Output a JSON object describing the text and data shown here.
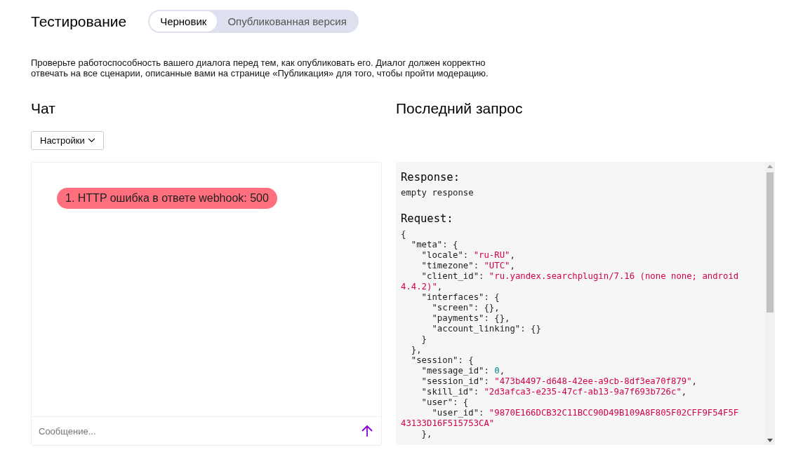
{
  "header": {
    "title": "Тестирование",
    "tabs": [
      {
        "label": "Черновик",
        "selected": true
      },
      {
        "label": "Опубликованная версия",
        "selected": false
      }
    ]
  },
  "description": "Проверьте работоспособность вашего диалога перед тем, как опубликовать его. Диалог должен корректно отвечать на все сценарии, описанные вами на странице «Публикация» для того, чтобы пройти модерацию.",
  "chat": {
    "heading": "Чат",
    "settings_button": "Настройки",
    "messages": [
      {
        "text": "1. HTTP ошибка в ответе webhook: 500",
        "kind": "error"
      }
    ],
    "input": {
      "placeholder": "Сообщение..."
    }
  },
  "last_request": {
    "heading": "Последний запрос",
    "response_label": "Response:",
    "response_text": "empty response",
    "request_label": "Request:",
    "code_lines": [
      [
        {
          "kind": "plain",
          "text": "{"
        }
      ],
      [
        {
          "kind": "plain",
          "text": "  \"meta\": {"
        }
      ],
      [
        {
          "kind": "plain",
          "text": "    \"locale\": "
        },
        {
          "kind": "string",
          "text": "\"ru-RU\""
        },
        {
          "kind": "plain",
          "text": ","
        }
      ],
      [
        {
          "kind": "plain",
          "text": "    \"timezone\": "
        },
        {
          "kind": "string",
          "text": "\"UTC\""
        },
        {
          "kind": "plain",
          "text": ","
        }
      ],
      [
        {
          "kind": "plain",
          "text": "    \"client_id\": "
        },
        {
          "kind": "string",
          "text": "\"ru.yandex.searchplugin/7.16 (none none; android"
        }
      ],
      [
        {
          "kind": "string",
          "text": "4.4.2)\""
        },
        {
          "kind": "plain",
          "text": ","
        }
      ],
      [
        {
          "kind": "plain",
          "text": "    \"interfaces\": {"
        }
      ],
      [
        {
          "kind": "plain",
          "text": "      \"screen\": {},"
        }
      ],
      [
        {
          "kind": "plain",
          "text": "      \"payments\": {},"
        }
      ],
      [
        {
          "kind": "plain",
          "text": "      \"account_linking\": {}"
        }
      ],
      [
        {
          "kind": "plain",
          "text": "    }"
        }
      ],
      [
        {
          "kind": "plain",
          "text": "  },"
        }
      ],
      [
        {
          "kind": "plain",
          "text": "  \"session\": {"
        }
      ],
      [
        {
          "kind": "plain",
          "text": "    \"message_id\": "
        },
        {
          "kind": "number",
          "text": "0"
        },
        {
          "kind": "plain",
          "text": ","
        }
      ],
      [
        {
          "kind": "plain",
          "text": "    \"session_id\": "
        },
        {
          "kind": "string",
          "text": "\"473b4497-d648-42ee-a9cb-8df3ea70f879\""
        },
        {
          "kind": "plain",
          "text": ","
        }
      ],
      [
        {
          "kind": "plain",
          "text": "    \"skill_id\": "
        },
        {
          "kind": "string",
          "text": "\"2d3afca3-e235-47cf-ab13-9a7f693b726c\""
        },
        {
          "kind": "plain",
          "text": ","
        }
      ],
      [
        {
          "kind": "plain",
          "text": "    \"user\": {"
        }
      ],
      [
        {
          "kind": "plain",
          "text": "      \"user_id\": "
        },
        {
          "kind": "string",
          "text": "\"9870E166DCB32C11BCC90D49B109A8F805F02CFF9F54F5F"
        }
      ],
      [
        {
          "kind": "string",
          "text": "43133D16F515753CA\""
        }
      ],
      [
        {
          "kind": "plain",
          "text": "    },"
        }
      ]
    ]
  }
}
